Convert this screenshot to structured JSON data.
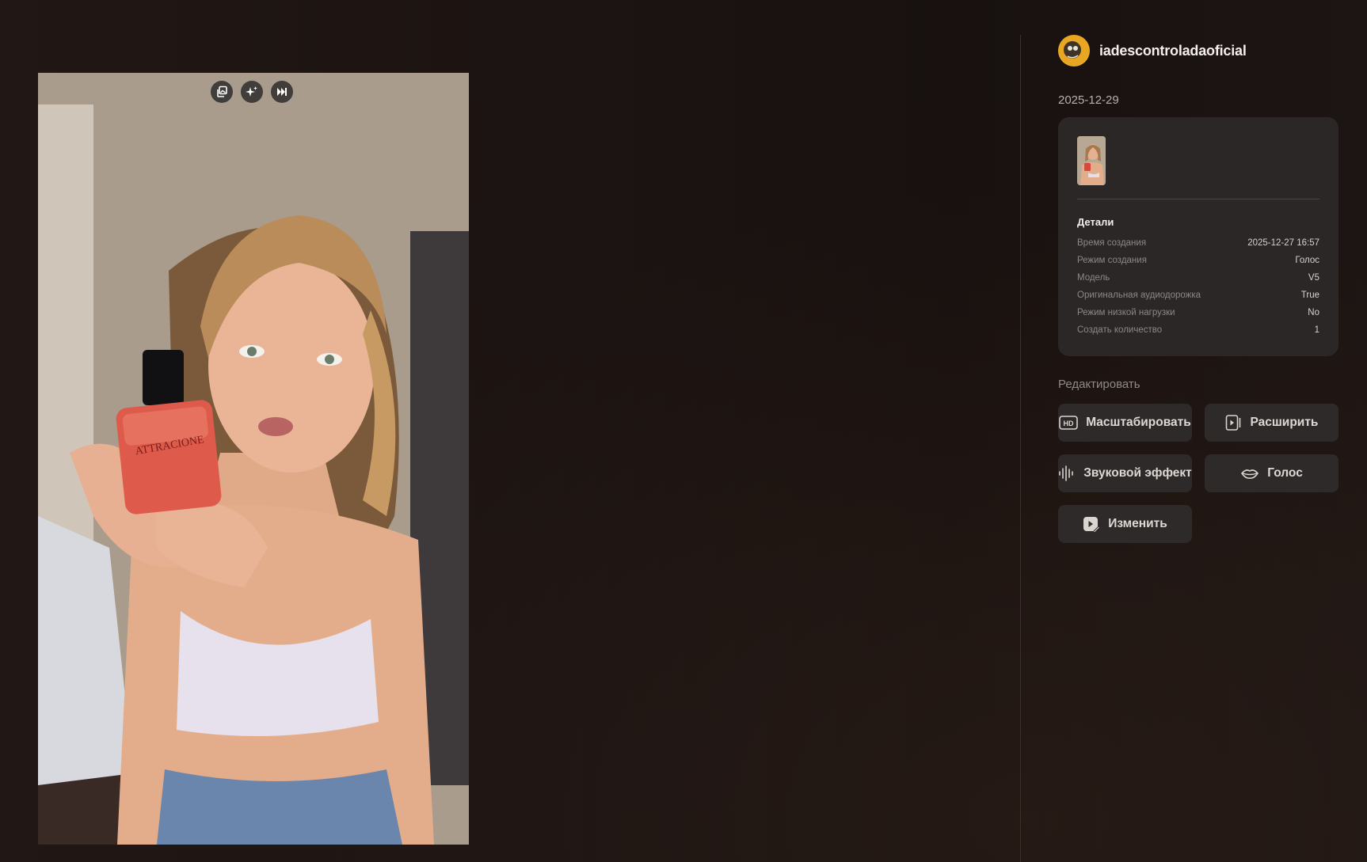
{
  "media": {
    "toolbar": [
      {
        "icon": "copy-image-icon"
      },
      {
        "icon": "sparkle-icon"
      },
      {
        "icon": "skip-next-icon"
      }
    ],
    "product_label": "ATTRACIONE"
  },
  "user": {
    "name": "iadescontroladaoficial",
    "date": "2025-12-29"
  },
  "details": {
    "title": "Детали",
    "rows": [
      {
        "label": "Время создания",
        "value": "2025-12-27 16:57"
      },
      {
        "label": "Режим создания",
        "value": "Голос"
      },
      {
        "label": "Модель",
        "value": "V5"
      },
      {
        "label": "Оригинальная аудиодорожка",
        "value": "True"
      },
      {
        "label": "Режим низкой нагрузки",
        "value": "No"
      },
      {
        "label": "Создать количество",
        "value": "1"
      }
    ]
  },
  "edit": {
    "title": "Редактировать",
    "buttons": [
      {
        "label": "Масштабировать",
        "icon": "hd-icon"
      },
      {
        "label": "Расширить",
        "icon": "extend-video-icon"
      },
      {
        "label": "Звуковой эффект",
        "icon": "sound-wave-icon"
      },
      {
        "label": "Голос",
        "icon": "lips-icon"
      },
      {
        "label": "Изменить",
        "icon": "edit-video-icon"
      }
    ]
  }
}
